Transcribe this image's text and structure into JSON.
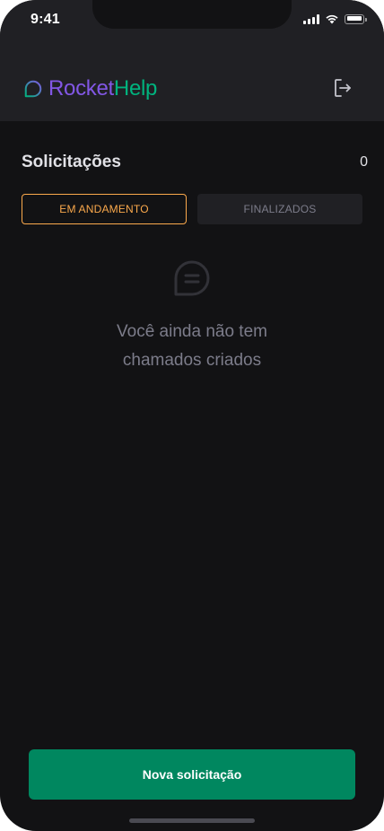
{
  "status_bar": {
    "time": "9:41",
    "icons": [
      "cellular-signal-icon",
      "wifi-icon",
      "battery-icon"
    ]
  },
  "header": {
    "logo_part1": "Rocket",
    "logo_part2": "Help",
    "logo_icon": "chat-bubble-icon",
    "logout_icon": "sign-out-icon"
  },
  "main": {
    "title": "Solicitações",
    "count": "0",
    "tabs": [
      {
        "label": "EM ANDAMENTO",
        "active": true
      },
      {
        "label": "FINALIZADOS",
        "active": false
      }
    ],
    "empty_state": {
      "icon": "chat-bubble-icon",
      "line1": "Você ainda não tem",
      "line2": "chamados criados"
    }
  },
  "footer": {
    "new_request_label": "Nova solicitação"
  },
  "colors": {
    "background": "#121214",
    "header": "#202024",
    "brand_purple": "#8257E5",
    "brand_green": "#00B37E",
    "button_green": "#00875F",
    "active_tab": "#FBA94C",
    "muted_text": "#7C7C8A"
  }
}
